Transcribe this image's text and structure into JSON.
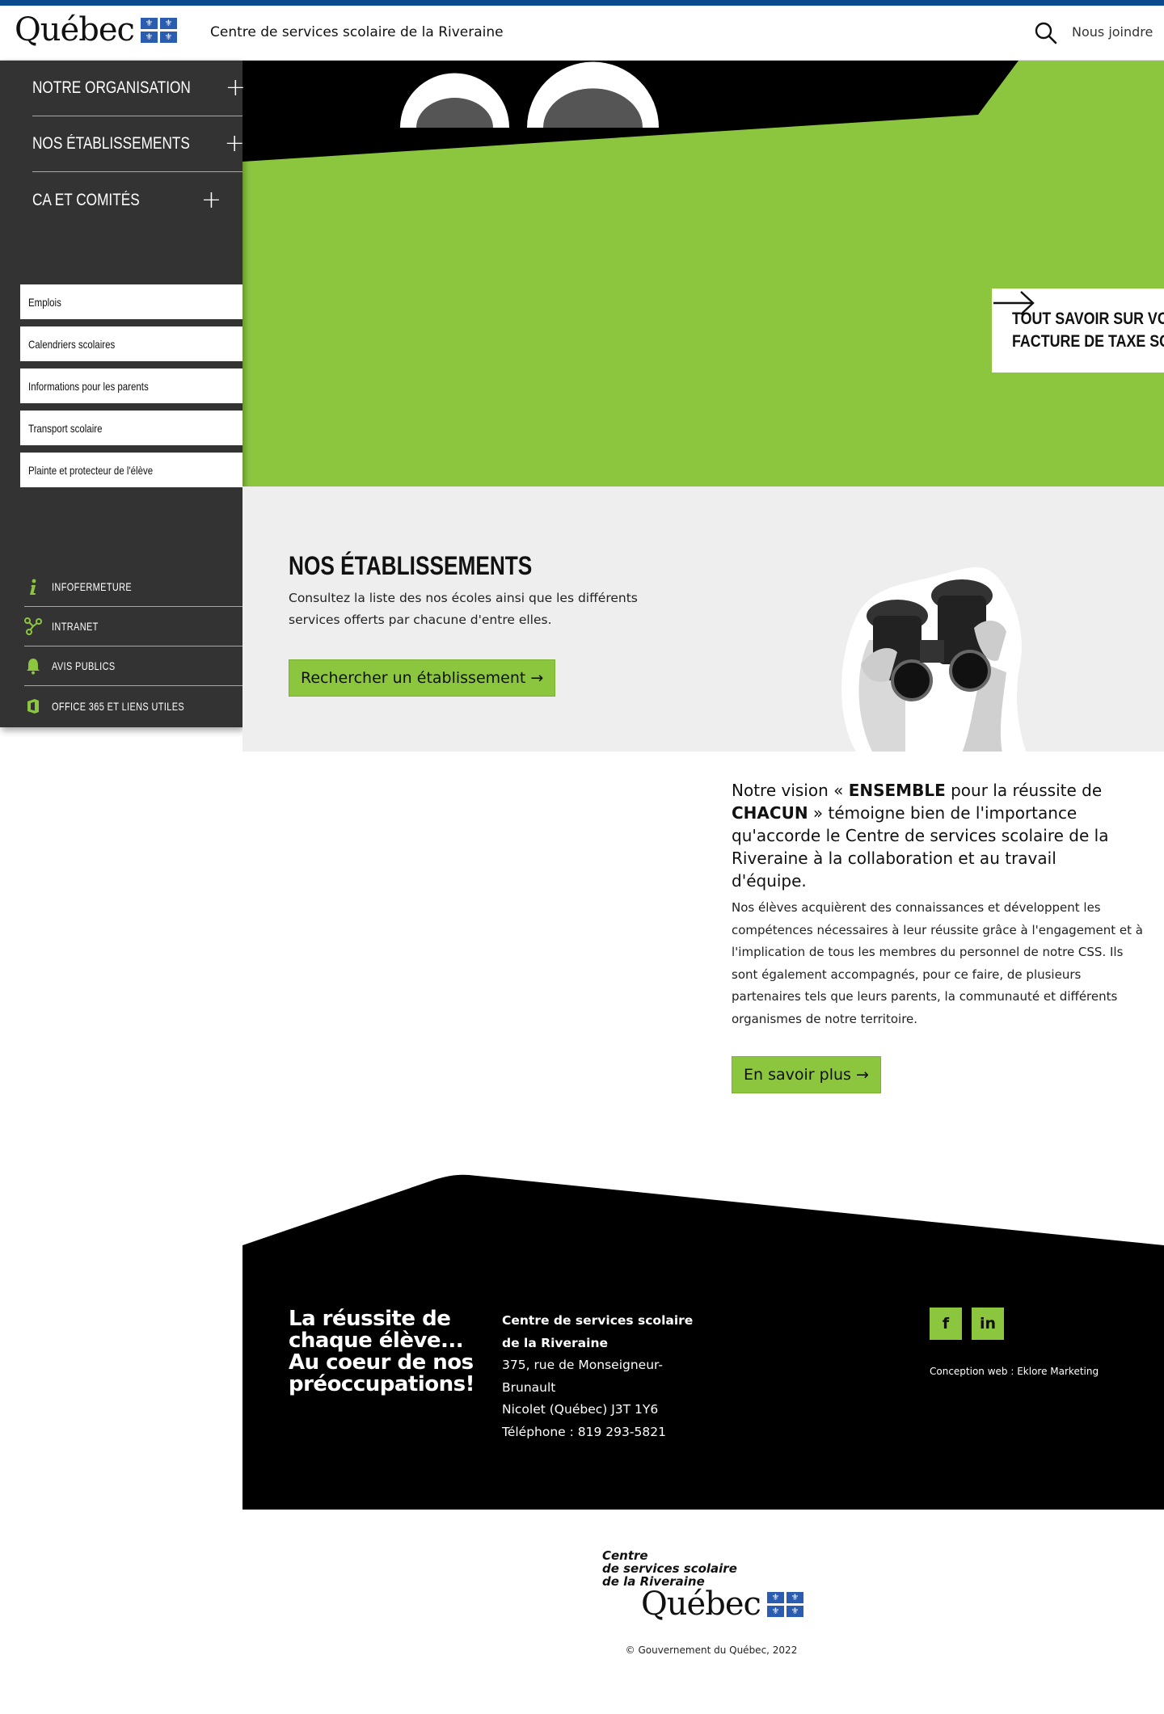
{
  "header": {
    "logo_text": "Québec",
    "title": "Centre de services scolaire de la Riveraine",
    "contact_label": "Nous joindre",
    "search_icon": "search-icon",
    "brand_color": "#0b4a8f"
  },
  "sidebar": {
    "main_nav": [
      {
        "label": "NOTRE ORGANISATION"
      },
      {
        "label": "NOS ÉTABLISSEMENTS"
      },
      {
        "label": "CA ET COMITÉS"
      }
    ],
    "quick_links": [
      {
        "label": "Emplois"
      },
      {
        "label": "Calendriers scolaires"
      },
      {
        "label": "Informations pour les parents"
      },
      {
        "label": "Transport scolaire"
      },
      {
        "label": "Plainte et protecteur de l'élève"
      }
    ],
    "utility_links": [
      {
        "label": "INFOFERMETURE",
        "icon": "info-icon"
      },
      {
        "label": "INTRANET",
        "icon": "network-icon"
      },
      {
        "label": "AVIS PUBLICS",
        "icon": "bell-icon"
      },
      {
        "label": "OFFICE 365 ET LIENS UTILES",
        "icon": "office-icon"
      }
    ]
  },
  "hero": {
    "card_text": "TOUT SAVOIR SUR VOTRE FACTURE DE TAXE SCOLAIRE",
    "accent_color": "#8cc63f"
  },
  "etablissements": {
    "title": "NOS ÉTABLISSEMENTS",
    "description": "Consultez la liste des nos écoles ainsi que les différents services offerts par chacune d'entre elles.",
    "button_label": "Rechercher un établissement →"
  },
  "vision": {
    "lead_part1": "Notre vision « ",
    "lead_bold1": "ENSEMBLE",
    "lead_part2": " pour la réussite de ",
    "lead_bold2": "CHACUN",
    "lead_part3": " » témoigne bien de l'importance qu'accorde le Centre de services scolaire de la Riveraine à la collaboration et au travail d'équipe.",
    "body": "Nos élèves acquièrent des connaissances et développent les compétences nécessaires à leur réussite grâce à l'engagement et à l'implication de tous les membres du personnel de notre CSS. Ils sont également accompagnés, pour ce faire, de plusieurs partenaires tels que leurs parents, la communauté et différents organismes de notre territoire.",
    "button_label": "En savoir plus →"
  },
  "footer": {
    "tagline": "La réussite de chaque élève... Au coeur de nos préoccupations!",
    "org_name": "Centre de services scolaire de la Riveraine",
    "address_line1": "375, rue de Monseigneur-Brunault",
    "address_line2": "Nicolet (Québec) J3T 1Y6",
    "phone": "Téléphone : 819 293-5821",
    "social_facebook": "f",
    "social_linkedin": "in",
    "credit": "Conception web : Eklore Marketing"
  },
  "bottom": {
    "logo_line1": "Centre",
    "logo_line2": "de services scolaire",
    "logo_line3": "de la Riveraine",
    "logo_quebec": "Québec",
    "copyright": "© Gouvernement du Québec, 2022"
  }
}
